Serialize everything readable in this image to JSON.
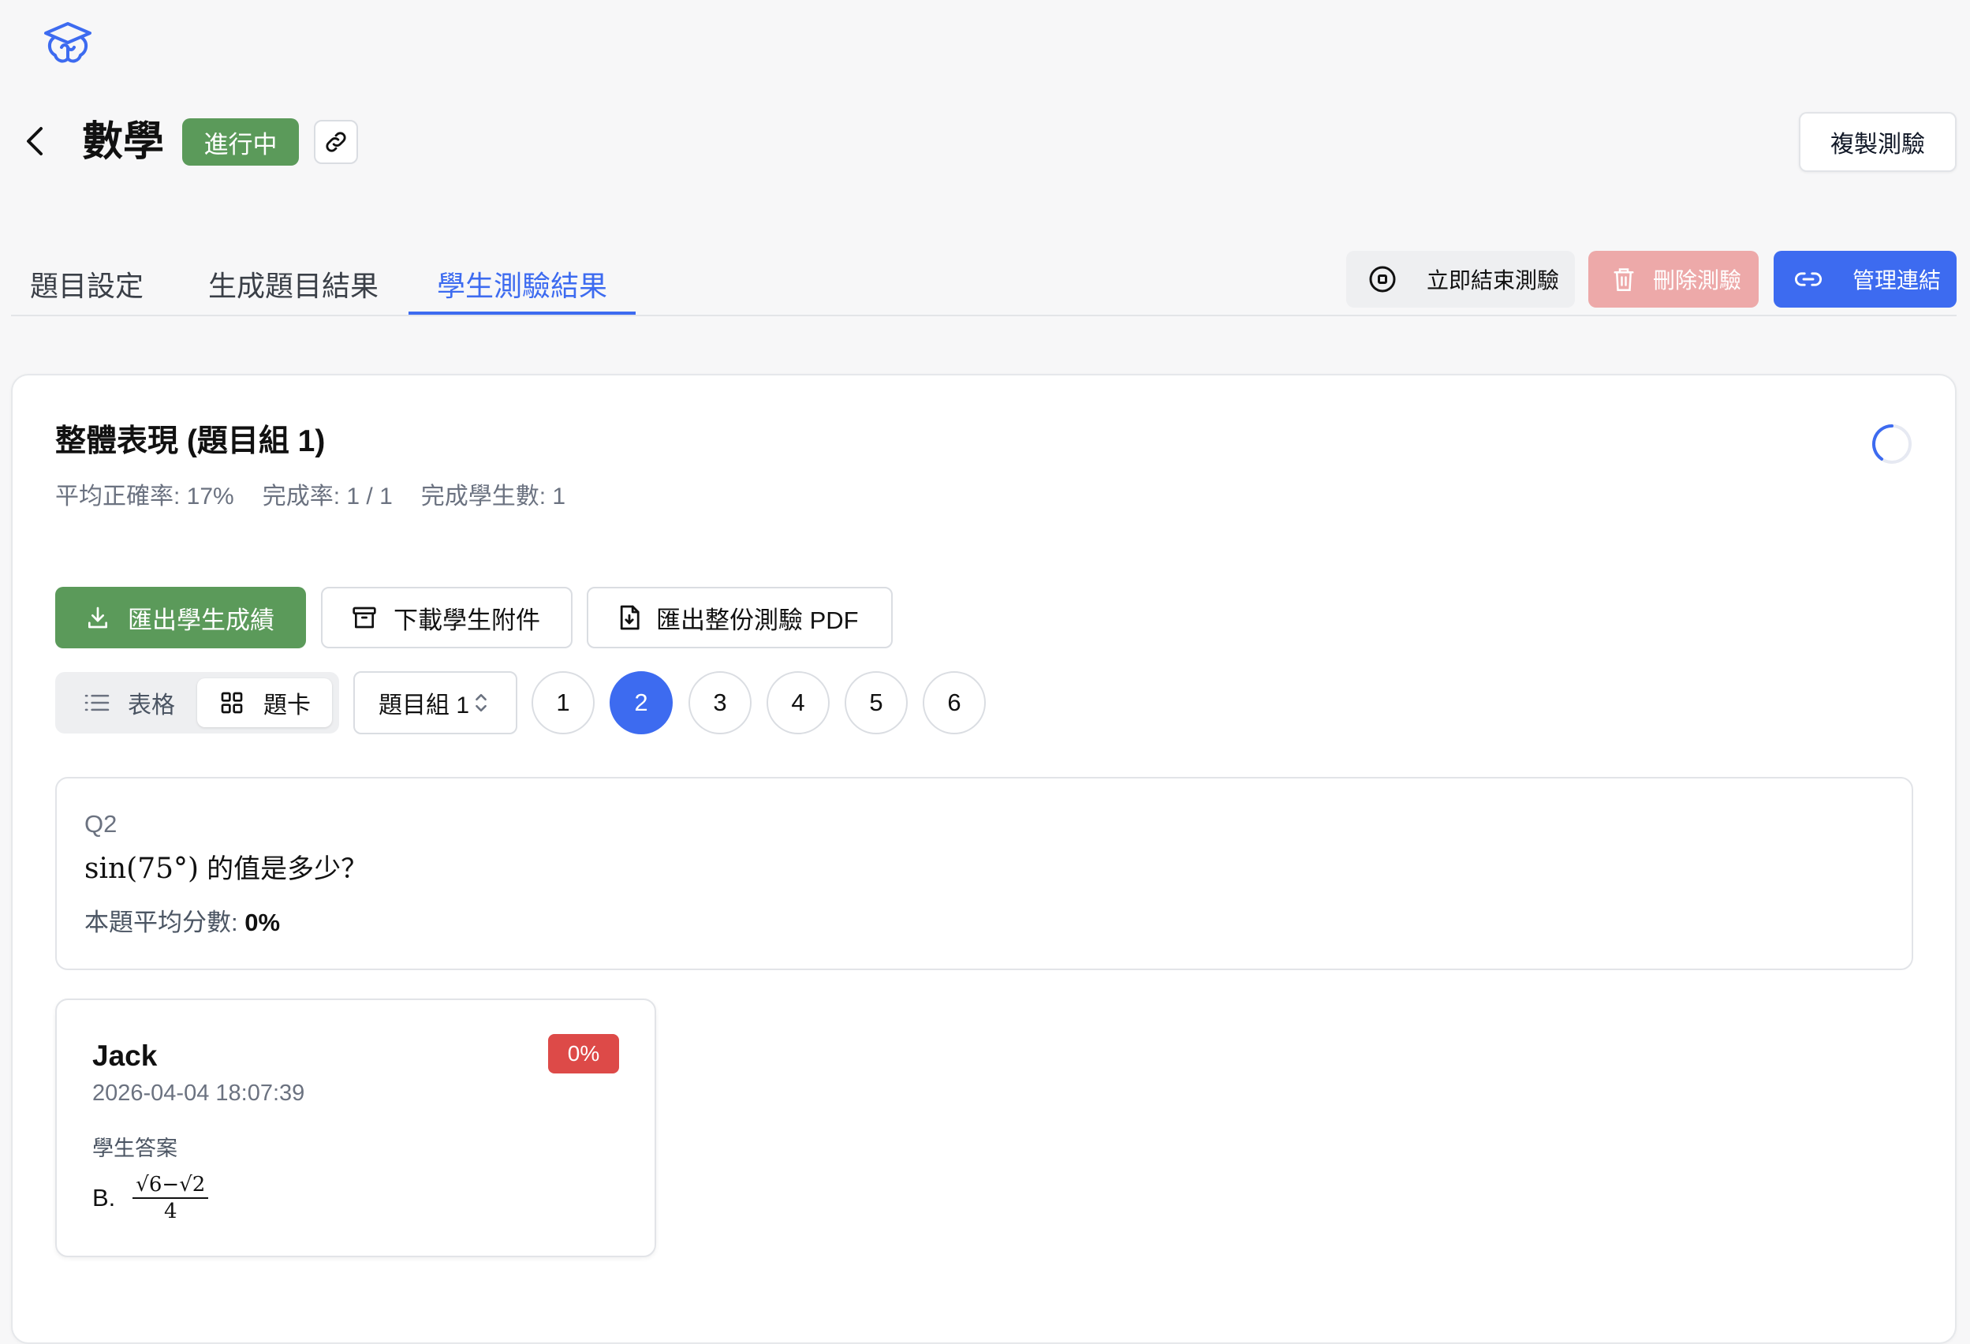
{
  "header": {
    "title": "數學",
    "status": "進行中",
    "copy_label": "複製測驗"
  },
  "tabs": [
    {
      "label": "題目設定",
      "active": false
    },
    {
      "label": "生成題目結果",
      "active": false
    },
    {
      "label": "學生測驗結果",
      "active": true
    }
  ],
  "actions": {
    "end_label": "立即結束測驗",
    "delete_label": "刪除測驗",
    "manage_label": "管理連結"
  },
  "summary": {
    "title": "整體表現 (題目組 1)",
    "avg_accuracy": "平均正確率: 17%",
    "completion": "完成率: 1 / 1",
    "completed_students": "完成學生數: 1"
  },
  "exports": {
    "export_scores": "匯出學生成績",
    "download_attachments": "下載學生附件",
    "export_pdf": "匯出整份測驗 PDF"
  },
  "view": {
    "table_label": "表格",
    "card_label": "題卡",
    "selected": "card",
    "group_select": "題目組 1"
  },
  "question_numbers": [
    "1",
    "2",
    "3",
    "4",
    "5",
    "6"
  ],
  "active_question": "2",
  "question": {
    "id": "Q2",
    "math": "sin(75°)",
    "text": "的值是多少？",
    "avg_label": "本題平均分數: ",
    "avg_value": "0%"
  },
  "student": {
    "name": "Jack",
    "time": "2026-04-04 18:07:39",
    "score": "0%",
    "answer_label": "學生答案",
    "answer_option": "B.",
    "answer_num": "√6−√2",
    "answer_den": "4"
  },
  "colors": {
    "primary": "#3d6bf0",
    "success": "#5b9a5a",
    "danger": "#dd4a48",
    "danger_soft": "#eda9a9"
  }
}
